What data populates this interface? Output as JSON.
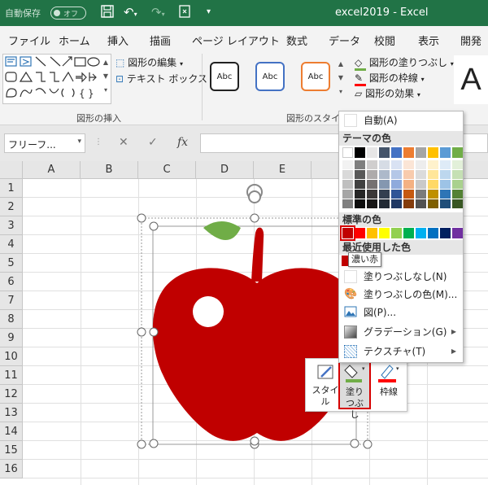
{
  "titlebar": {
    "autosave_label": "自動保存",
    "autosave_state": "オフ",
    "title": "excel2019  -  Excel",
    "bg_color": "#217346"
  },
  "tabs": [
    "ファイル",
    "ホーム",
    "挿入",
    "描画",
    "ページ レイアウト",
    "数式",
    "データ",
    "校閲",
    "表示",
    "開発"
  ],
  "ribbon": {
    "edit_shape": "図形の編集",
    "text_box": "テキスト ボックス",
    "group_insert_shapes": "図形の挿入",
    "style_sample": "Abc",
    "group_shape_styles": "図形のスタイル",
    "fill": "図形の塗りつぶし",
    "outline": "図形の枠線",
    "effects": "図形の効果",
    "wordart": "A"
  },
  "formulabar": {
    "namebox": "フリーフ...",
    "fx": "fx"
  },
  "columns": [
    "A",
    "B",
    "C",
    "D",
    "E"
  ],
  "rows": [
    "1",
    "2",
    "3",
    "4",
    "5",
    "6",
    "7",
    "8",
    "9",
    "10",
    "11",
    "12",
    "13",
    "14",
    "15",
    "16"
  ],
  "dropdown": {
    "auto": "自動(A)",
    "theme_header": "テーマの色",
    "standard_header": "標準の色",
    "recent_header": "最近使用した色",
    "no_fill": "塗りつぶしなし(N)",
    "more_colors": "塗りつぶしの色(M)...",
    "picture": "図(P)...",
    "gradient": "グラデーション(G)",
    "texture": "テクスチャ(T)",
    "tooltip": "濃い赤",
    "theme_colors": [
      [
        "#ffffff",
        "#000000",
        "#e7e6e6",
        "#44546a",
        "#4472c4",
        "#ed7d31",
        "#a5a5a5",
        "#ffc000",
        "#5b9bd5",
        "#70ad47"
      ],
      [
        "#f2f2f2",
        "#7f7f7f",
        "#d0cece",
        "#d6dce5",
        "#d9e2f3",
        "#fbe5d6",
        "#ededed",
        "#fff2cc",
        "#deebf7",
        "#e2f0d9"
      ],
      [
        "#d9d9d9",
        "#595959",
        "#aeabab",
        "#adb9ca",
        "#b4c7e7",
        "#f8cbad",
        "#dbdbdb",
        "#ffe699",
        "#bdd7ee",
        "#c5e0b4"
      ],
      [
        "#bfbfbf",
        "#404040",
        "#757171",
        "#8497b0",
        "#8faadc",
        "#f4b183",
        "#c9c9c9",
        "#ffd966",
        "#9dc3e6",
        "#a9d18e"
      ],
      [
        "#a6a6a6",
        "#262626",
        "#3b3838",
        "#333f50",
        "#2f5597",
        "#c55a11",
        "#7b7b7b",
        "#bf9000",
        "#2e75b6",
        "#548235"
      ],
      [
        "#7f7f7f",
        "#0d0d0d",
        "#171616",
        "#222a35",
        "#1f3864",
        "#843c0c",
        "#525252",
        "#7f6000",
        "#1f4e79",
        "#385723"
      ]
    ],
    "standard_colors": [
      "#c00000",
      "#ff0000",
      "#ffc000",
      "#ffff00",
      "#92d050",
      "#00b050",
      "#00b0f0",
      "#0070c0",
      "#002060",
      "#7030a0"
    ],
    "recent_color": "#c00000"
  },
  "mini_toolbar": {
    "style": "スタイル",
    "fill": "塗りつぶし",
    "outline": "枠線"
  },
  "shape": {
    "apple_color": "#c00000",
    "leaf_color": "#70ad47"
  }
}
